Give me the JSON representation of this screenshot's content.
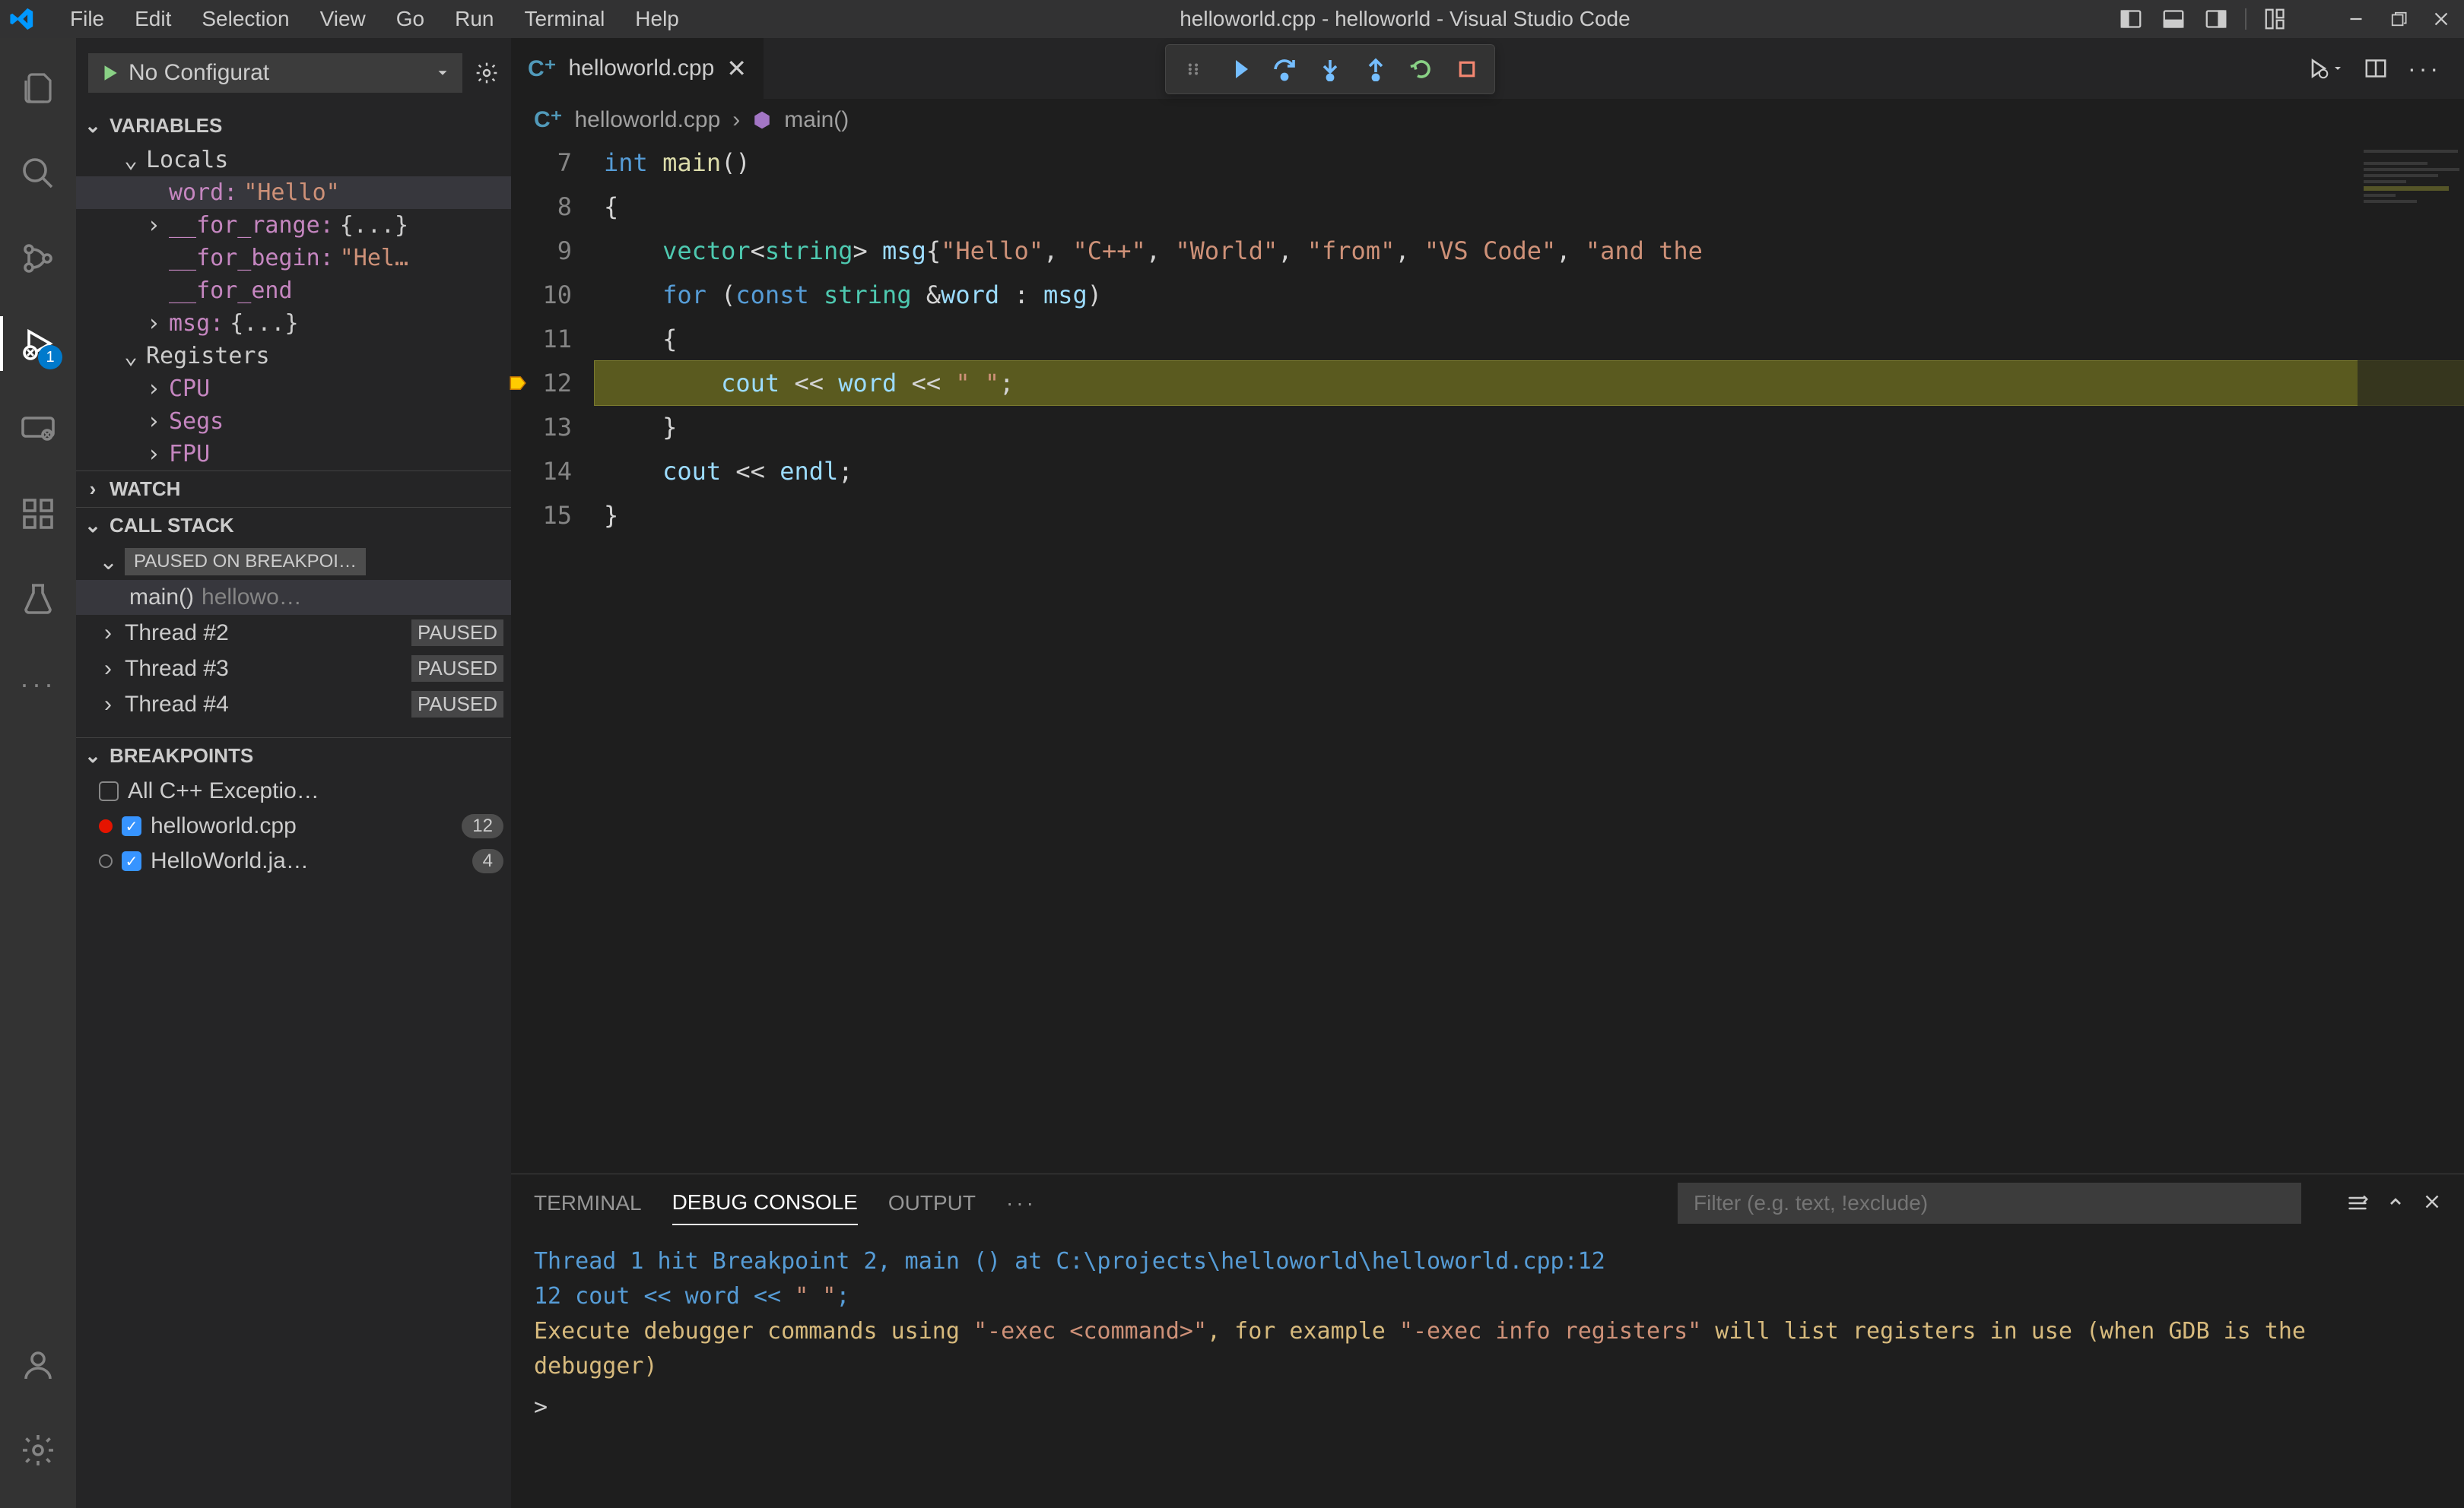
{
  "window": {
    "title": "helloworld.cpp - helloworld - Visual Studio Code"
  },
  "menu": [
    "File",
    "Edit",
    "Selection",
    "View",
    "Go",
    "Run",
    "Terminal",
    "Help"
  ],
  "runConfig": {
    "label": "No Configurat",
    "gear": "⚙"
  },
  "sections": {
    "variables": "VARIABLES",
    "locals": "Locals",
    "registers": "Registers",
    "watch": "WATCH",
    "callstack": "CALL STACK",
    "breakpoints": "BREAKPOINTS"
  },
  "vars": {
    "wordName": "word:",
    "wordVal": "\"Hello\"",
    "forRange": "__for_range:",
    "forRangeVal": "{...}",
    "forBegin": "__for_begin:",
    "forBeginVal": "\"Hel…",
    "forEnd": "__for_end",
    "msg": "msg:",
    "msgVal": "{...}"
  },
  "registers": [
    "CPU",
    "Segs",
    "FPU"
  ],
  "callstack": {
    "pausedOn": "PAUSED ON BREAKPOI…",
    "mainFrame": "main()",
    "mainLoc": "hellowo…",
    "threads": [
      {
        "name": "Thread #2",
        "state": "PAUSED"
      },
      {
        "name": "Thread #3",
        "state": "PAUSED"
      },
      {
        "name": "Thread #4",
        "state": "PAUSED"
      }
    ]
  },
  "breakpoints": {
    "allCpp": "All C++ Exceptio…",
    "bp1": "helloworld.cpp",
    "bp1count": "12",
    "bp2": "HelloWorld.ja…",
    "bp2count": "4"
  },
  "tab": {
    "filename": "helloworld.cpp"
  },
  "breadcrumb": {
    "file": "helloworld.cpp",
    "symbol": "main()"
  },
  "code": {
    "ln7": "7",
    "ln8": "8",
    "ln9": "9",
    "ln10": "10",
    "ln11": "11",
    "ln12": "12",
    "ln13": "13",
    "ln14": "14",
    "ln15": "15"
  },
  "panel": {
    "terminal": "TERMINAL",
    "debugConsole": "DEBUG CONSOLE",
    "output": "OUTPUT",
    "filterPlaceholder": "Filter (e.g. text, !exclude)"
  },
  "console": {
    "line1a": "Thread 1 hit Breakpoint 2, main () at C:\\projects\\helloworld\\helloworld.cpp:12",
    "line2a": "12",
    "line2b": "             cout << word << ",
    "line2c": "\" \"",
    "line2d": ";",
    "line3a": "Execute debugger commands using ",
    "line3b": "\"-exec <command>\"",
    "line3c": ", for example ",
    "line3d": "\"-exec info registers\"",
    "line3e": " will list registers in use (when GDB is the debugger)",
    "prompt": ">"
  },
  "activity": {
    "debugBadge": "1"
  }
}
